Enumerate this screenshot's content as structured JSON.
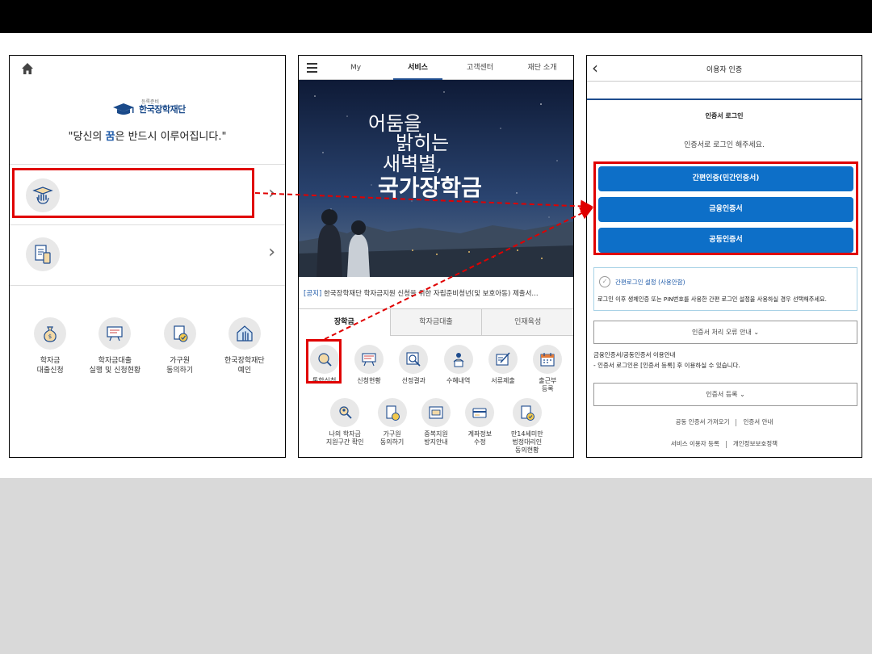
{
  "colors": {
    "annotation_red": "#e00000",
    "primary_blue": "#0d6fc8",
    "navy": "#1e4c8e",
    "slide_bottom_gray": "#d9d9d9"
  },
  "panel1": {
    "home_icon": "home-icon",
    "logo_small_text": "등록준비",
    "logo_text": "한국장학재단",
    "slogan_prefix": "\"당신의 ",
    "slogan_highlight": "꿈",
    "slogan_suffix": "은 반드시 이루어집니다.\"",
    "menu_rows": [
      {
        "icon": "graduation-hand-icon"
      },
      {
        "icon": "document-phone-icon"
      }
    ],
    "quick_items": [
      {
        "icon": "money-bag-icon",
        "label": "학자금\n대출신청"
      },
      {
        "icon": "board-icon",
        "label": "학자금대출\n실행 및 신청현황"
      },
      {
        "icon": "document-check-icon",
        "label": "가구원\n동의하기"
      },
      {
        "icon": "home-hand-icon",
        "label": "한국장학재단\n예인"
      }
    ]
  },
  "panel2": {
    "nav_tabs": [
      "My",
      "서비스",
      "고객센터",
      "재단 소개"
    ],
    "active_tab_index": 1,
    "banner_lines": [
      "어둠을",
      "밝히는",
      "새벽별,",
      "국가장학금"
    ],
    "carousel_dot_count": 6,
    "carousel_active_dot": 0,
    "notice_tag": "[공지]",
    "notice_text": " 한국장학재단 학자금지원 신청을 위한 자립준비청년(및 보호아동) 제출서...",
    "sub_tabs": [
      "장학금",
      "학자금대출",
      "인재육성"
    ],
    "active_sub_tab": 0,
    "services_row1": [
      {
        "icon": "search-doc-icon",
        "label": "통합신청"
      },
      {
        "icon": "board-icon",
        "label": "신청현황"
      },
      {
        "icon": "magnifier-icon",
        "label": "선정결과"
      },
      {
        "icon": "person-doc-icon",
        "label": "수혜내역"
      },
      {
        "icon": "pen-doc-icon",
        "label": "서류제출"
      },
      {
        "icon": "calendar-icon",
        "label": "출근부\n등록"
      }
    ],
    "services_row2": [
      {
        "icon": "people-search-icon",
        "label": "나의 학자금\n지원구간 확인"
      },
      {
        "icon": "document-coin-icon",
        "label": "가구원\n동의하기"
      },
      {
        "icon": "window-doc-icon",
        "label": "중복지원\n방지안내"
      },
      {
        "icon": "bank-card-icon",
        "label": "계좌정보\n수정"
      },
      {
        "icon": "document-check-icon",
        "label": "만14세미만\n법정대리인\n동의현황"
      }
    ]
  },
  "panel3": {
    "title": "이용자 인증",
    "section_title": "인증서 로그인",
    "subtitle": "인증서로 로그인 해주세요.",
    "auth_buttons": [
      "간편인증(민간인증서)",
      "금융인증서",
      "공동인증서"
    ],
    "simple_login_title": "간편로그인 설정 (사용안함)",
    "simple_login_desc": "로그인 이후 생체인증 또는 PIN번호를 사용한 간편 로그인 설정을 사용하실 경우 선택해주세요.",
    "error_guide_button": "인증서 처리 오류 안내",
    "info_title": "금융인증서/공동인증서 이용안내",
    "info_desc": "- 인증서 로그인은 [인증서 등록] 후 이용하실 수 있습니다.",
    "register_button": "인증서 등록",
    "footer_links_1": [
      "공동 인증서 가져오기",
      "인증서 안내"
    ],
    "footer_links_2": [
      "서비스 이용자 등록",
      "개인정보보호정책"
    ]
  }
}
